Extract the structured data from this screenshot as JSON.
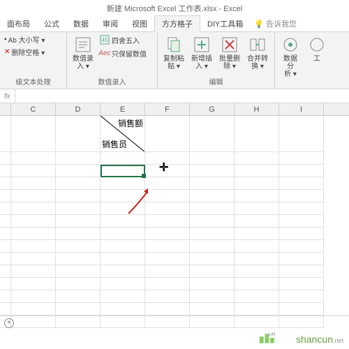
{
  "title": "新建 Microsoft Excel 工作表.xlsx - Excel",
  "tabs": [
    "面布局",
    "公式",
    "数据",
    "审阅",
    "视图",
    "方方格子",
    "DIY工具箱"
  ],
  "active_tab": "方方格子",
  "tell_me": "告诉我您",
  "ribbon": {
    "g1": {
      "btn_case": "Ab 大小写 ▾",
      "btn_delspace": "删除空格 ▾",
      "label": "级文本处理"
    },
    "g2": {
      "btn_numrec": "数值录\n入 ▾",
      "btn_round": "四舍五入",
      "btn_onlynum": "只保留数值",
      "label": "数值录入"
    },
    "g3": {
      "b1": "复制粘\n贴 ▾",
      "b2": "新增插\n入 ▾",
      "b3": "批量删\n除 ▾",
      "b4": "合并转\n换 ▾",
      "label": "编辑"
    },
    "g4": {
      "b1": "数据分\n析 ▾",
      "b2": "工"
    }
  },
  "formula": {
    "fx": "fx"
  },
  "columns": [
    "C",
    "D",
    "E",
    "F",
    "G",
    "H",
    "I"
  ],
  "cell_data": {
    "top": "销售额",
    "bottom": "销售员"
  },
  "watermark": {
    "text": "shancun",
    "suffix": ".net",
    "tagline": "山村"
  }
}
